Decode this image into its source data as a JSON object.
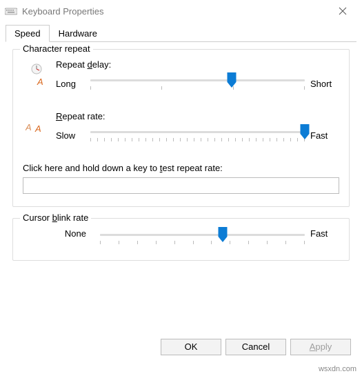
{
  "window": {
    "title": "Keyboard Properties"
  },
  "tabs": {
    "speed": "Speed",
    "hardware": "Hardware"
  },
  "characterRepeat": {
    "legend": "Character repeat",
    "delay": {
      "label_prefix": "Repeat ",
      "label_ak": "d",
      "label_suffix": "elay:",
      "left": "Long",
      "right": "Short",
      "value_percent": 66
    },
    "rate": {
      "label_ak": "R",
      "label_suffix": "epeat rate:",
      "left": "Slow",
      "right": "Fast",
      "value_percent": 100
    },
    "test": {
      "label_prefix": "Click here and hold down a key to ",
      "label_ak": "t",
      "label_suffix": "est repeat rate:",
      "value": ""
    }
  },
  "cursorBlink": {
    "legend_prefix": "Cursor ",
    "legend_ak": "b",
    "legend_suffix": "link rate",
    "left": "None",
    "right": "Fast",
    "value_percent": 60
  },
  "buttons": {
    "ok": "OK",
    "cancel": "Cancel",
    "apply_ak": "A",
    "apply_suffix": "pply"
  },
  "watermark": "wsxdn.com"
}
